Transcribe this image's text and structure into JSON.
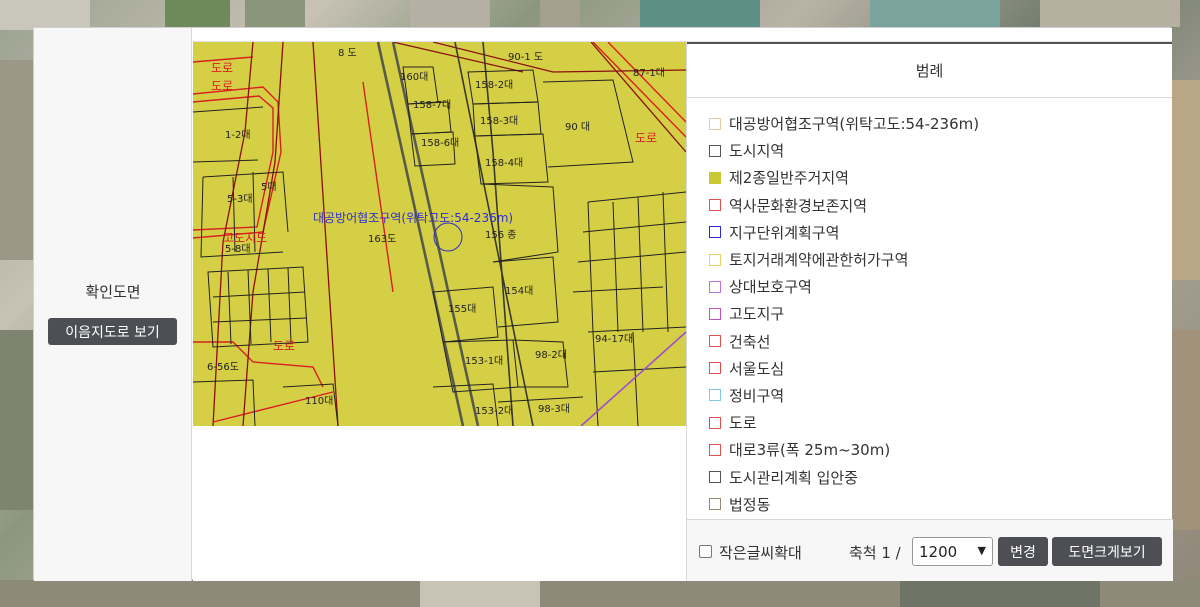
{
  "left": {
    "title": "확인도면",
    "view_button": "이음지도로 보기"
  },
  "map": {
    "zone_label": "대공방어협조구역(위탁고도:54-236m)",
    "parcels": [
      "8 도",
      "90-1 도",
      "87-1대",
      "160대",
      "158-2대",
      "158-7대",
      "158-3대",
      "90 대",
      "1-2대",
      "158-6대",
      "5대",
      "158-4대",
      "5-3대",
      "163도",
      "156 종",
      "5-8대",
      "154대",
      "155대",
      "153-1대",
      "98-2대",
      "94-17대",
      "6-56도",
      "110대",
      "153-2대",
      "98-3대"
    ],
    "road_labels": [
      "도로",
      "도로",
      "도로",
      "고도지도",
      "도로"
    ]
  },
  "legend": {
    "title": "범례",
    "items": [
      {
        "label": "대공방어협조구역(위탁고도:54-236m)",
        "color": "#e8c9a3",
        "filled": false
      },
      {
        "label": "도시지역",
        "color": "#555555",
        "filled": false
      },
      {
        "label": "제2종일반주거지역",
        "color": "#c8c832",
        "filled": true
      },
      {
        "label": "역사문화환경보존지역",
        "color": "#e05050",
        "filled": false
      },
      {
        "label": "지구단위계획구역",
        "color": "#2a2ad0",
        "filled": false
      },
      {
        "label": "토지거래계약에관한허가구역",
        "color": "#e8d060",
        "filled": false
      },
      {
        "label": "상대보호구역",
        "color": "#c070e0",
        "filled": false
      },
      {
        "label": "고도지구",
        "color": "#c050c8",
        "filled": false
      },
      {
        "label": "건축선",
        "color": "#e05050",
        "filled": false
      },
      {
        "label": "서울도심",
        "color": "#e05050",
        "filled": false
      },
      {
        "label": "정비구역",
        "color": "#80c8f0",
        "filled": false
      },
      {
        "label": "도로",
        "color": "#e05050",
        "filled": false
      },
      {
        "label": "대로3류(폭 25m~30m)",
        "color": "#e05050",
        "filled": false
      },
      {
        "label": "도시관리계획 입안중",
        "color": "#555555",
        "filled": false
      },
      {
        "label": "법정동",
        "color": "#9a8a70",
        "filled": false
      }
    ]
  },
  "footer": {
    "small_text_label": "작은글씨확대",
    "small_text_checked": false,
    "scale_label": "축척 1 /",
    "scale_value": "1200",
    "change_button": "변경",
    "enlarge_button": "도면크게보기"
  }
}
